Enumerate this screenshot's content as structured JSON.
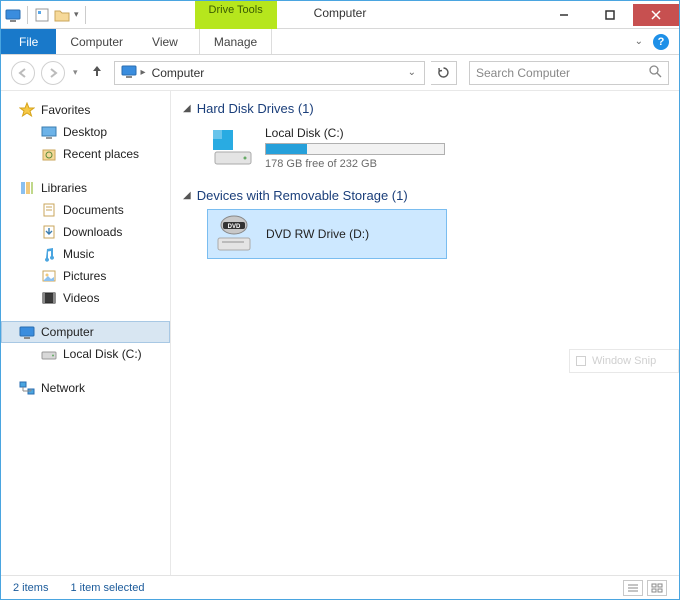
{
  "window": {
    "title": "Computer",
    "contextual_tab": "Drive Tools"
  },
  "ribbon": {
    "file": "File",
    "tabs": [
      "Computer",
      "View",
      "Manage"
    ]
  },
  "nav": {
    "location": "Computer",
    "search_placeholder": "Search Computer"
  },
  "sidebar": {
    "favorites": {
      "label": "Favorites",
      "items": [
        "Desktop",
        "Recent places"
      ]
    },
    "libraries": {
      "label": "Libraries",
      "items": [
        "Documents",
        "Downloads",
        "Music",
        "Pictures",
        "Videos"
      ]
    },
    "computer": {
      "label": "Computer",
      "items": [
        "Local Disk (C:)"
      ]
    },
    "network": {
      "label": "Network"
    }
  },
  "main": {
    "groups": [
      {
        "title": "Hard Disk Drives (1)",
        "drives": [
          {
            "name": "Local Disk (C:)",
            "free_text": "178 GB free of 232 GB",
            "used_pct": 23,
            "selected": false,
            "kind": "hdd"
          }
        ]
      },
      {
        "title": "Devices with Removable Storage (1)",
        "drives": [
          {
            "name": "DVD RW Drive (D:)",
            "free_text": "",
            "used_pct": null,
            "selected": true,
            "kind": "dvd"
          }
        ]
      }
    ]
  },
  "status": {
    "count": "2 items",
    "selection": "1 item selected"
  },
  "snip": "Window Snip"
}
